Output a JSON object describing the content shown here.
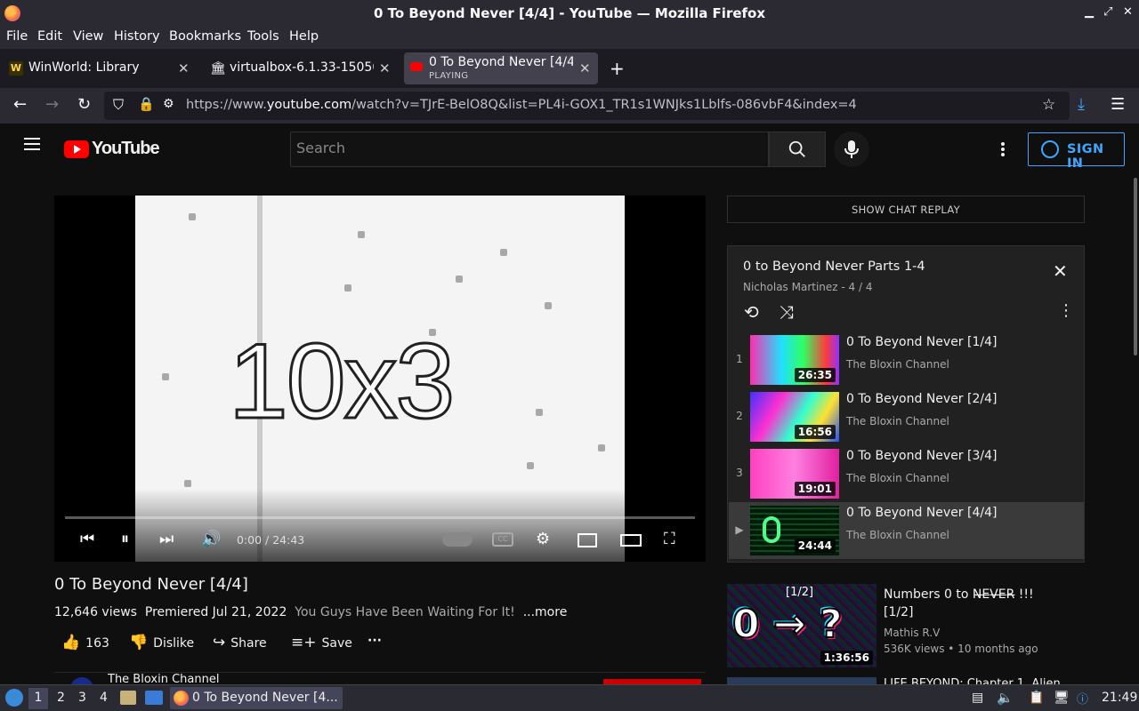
{
  "window": {
    "title": "0 To Beyond Never [4/4] - YouTube — Mozilla Firefox"
  },
  "menu": [
    "File",
    "Edit",
    "View",
    "History",
    "Bookmarks",
    "Tools",
    "Help"
  ],
  "tabs": [
    {
      "label": "WinWorld: Library",
      "icon": "winworld-icon"
    },
    {
      "label": "virtualbox-6.1.33-15050",
      "icon": "archive-icon"
    },
    {
      "label": "0 To Beyond Never [4/4]",
      "sublabel": "PLAYING",
      "icon": "youtube-icon",
      "active": true
    }
  ],
  "nav": {
    "url_prefix": "https://www.",
    "url_host": "youtube.com",
    "url_rest": "/watch?v=TJrE-BelO8Q&list=PL4i-GOX1_TR1s1WNJks1Lblfs-086vbF4&index=4"
  },
  "youtube": {
    "logo_text": "YouTube",
    "search_placeholder": "Search",
    "sign_in": "SIGN IN"
  },
  "player": {
    "frame_text": "10x3",
    "time": "0:00 / 24:43"
  },
  "video": {
    "title": "0 To Beyond Never [4/4]",
    "views": "12,646 views",
    "premiered": "Premiered Jul 21, 2022",
    "description": "You Guys Have Been Waiting For It!",
    "more": "...more",
    "likes": "163",
    "dislike": "Dislike",
    "share": "Share",
    "save": "Save",
    "channel_partial": "The Bloxin Channel"
  },
  "sidebar": {
    "chat_replay": "SHOW CHAT REPLAY",
    "playlist": {
      "title": "0 to Beyond Never Parts 1-4",
      "subtitle": "Nicholas Martinez - 4 / 4",
      "items": [
        {
          "index": "1",
          "title": "0 To Beyond Never [1/4]",
          "channel": "The Bloxin Channel",
          "duration": "26:35"
        },
        {
          "index": "2",
          "title": "0 To Beyond Never [2/4]",
          "channel": "The Bloxin Channel",
          "duration": "16:56"
        },
        {
          "index": "3",
          "title": "0 To Beyond Never [3/4]",
          "channel": "The Bloxin Channel",
          "duration": "19:01"
        },
        {
          "index": "▶",
          "title": "0 To Beyond Never [4/4]",
          "channel": "The Bloxin Channel",
          "duration": "24:44"
        }
      ]
    },
    "recommended": [
      {
        "title": "Numbers 0 to N̶E̶V̶E̶R̶ !!! [1/2]",
        "channel": "Mathis R.V",
        "meta": "536K views • 10 months ago",
        "duration": "1:36:56",
        "thumb_text": "0 → ?",
        "thumb_tag": "[1/2]"
      },
      {
        "title": "LIFE BEYOND: Chapter 1. Alien"
      }
    ]
  },
  "taskbar": {
    "workspaces": [
      "1",
      "2",
      "3",
      "4"
    ],
    "task_label": "0 To Beyond Never [4...",
    "clock": "21:49"
  },
  "colors": {
    "youtube_red": "#ff0000",
    "link_blue": "#3ea6ff",
    "firefox_chrome": "#2b2a33"
  }
}
